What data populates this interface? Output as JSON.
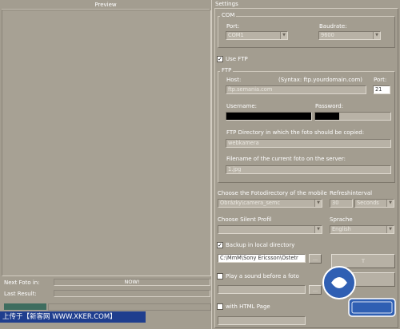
{
  "preview": {
    "title": "Preview"
  },
  "status": {
    "next_foto_label": "Next Foto in:",
    "next_foto_value": "NOW!",
    "last_result_label": "Last Result:",
    "last_result_value": ""
  },
  "settings": {
    "title": "Settings",
    "com": {
      "group_label": "COM",
      "port_label": "Port:",
      "port_value": "COM1",
      "baudrate_label": "Baudrate:",
      "baudrate_value": "9600"
    },
    "use_ftp": {
      "label": "Use FTP",
      "checked": true
    },
    "ftp": {
      "group_label": "FTP",
      "host_label": "Host:",
      "host_syntax": "(Syntax: ftp.yourdomain.com)",
      "host_value": "ftp.semania.com",
      "port_label": "Port:",
      "port_value": "21",
      "username_label": "Username:",
      "password_label": "Password:",
      "directory_label": "FTP Directory in which the foto should be copied:",
      "directory_value": "webkamera",
      "filename_label": "Filename of the current foto on the server:",
      "filename_value": "1.jpg"
    },
    "fotodirectory": {
      "label": "Choose the Fotodirectory of the mobile",
      "value": "Obrázky\\camera_semc"
    },
    "refresh": {
      "label": "Refreshinterval",
      "value": "30",
      "unit": "Seconds"
    },
    "silent_profil": {
      "label": "Choose Silent Profil",
      "value": ""
    },
    "sprache": {
      "label": "Sprache",
      "value": "English"
    },
    "backup": {
      "label": "Backup in local directory",
      "checked": true,
      "path": "C:\\MmM\\Sony Ericsson\\Ostetr",
      "browse": "..."
    },
    "sound": {
      "label": "Play a sound before a foto",
      "checked": false,
      "path": "",
      "browse": "..."
    },
    "html_page": {
      "label": "with HTML Page",
      "checked": false,
      "path": ""
    },
    "button_partial": "T"
  },
  "watermark": {
    "text": "上传于【新客网 WWW.XKER.COM】"
  },
  "colors": {
    "background": "#a39d90",
    "watermark_bg": "#1f3e8e"
  }
}
